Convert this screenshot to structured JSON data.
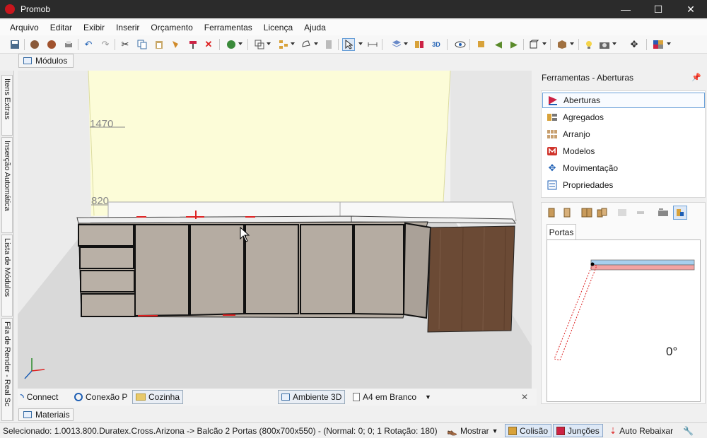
{
  "window": {
    "title": "Promob",
    "minimize": "—",
    "maximize": "☐",
    "close": "✕"
  },
  "menu": [
    "Arquivo",
    "Editar",
    "Exibir",
    "Inserir",
    "Orçamento",
    "Ferramentas",
    "Licença",
    "Ajuda"
  ],
  "toolbar_icons": [
    "save-icon",
    "render-icon",
    "render-settings-icon",
    "print-icon",
    "undo-icon",
    "redo-icon",
    "cut-icon",
    "copy-icon",
    "paste-icon",
    "paint-icon",
    "format-icon",
    "delete-icon",
    "budget-icon",
    "group-icon",
    "module-tree-icon",
    "shape-icon",
    "wall-icon",
    "pointer-icon",
    "measure-icon",
    "layers-icon",
    "elevation-icon",
    "3d-view-icon",
    "eye-icon",
    "rotate-icon",
    "move-left-icon",
    "move-right-icon",
    "view-cube-icon",
    "box-icon",
    "light-icon",
    "camera-icon",
    "move-cross-icon",
    "palette-icon"
  ],
  "modules_tab": {
    "label": "Módulos"
  },
  "side_tabs": [
    "Itens Extras",
    "Inserção Automática",
    "Lista de Módulos",
    "Fila de Render - Real Sc"
  ],
  "viewport": {
    "dimension_labels": [
      "1470",
      "820"
    ]
  },
  "view_tabs": {
    "connect": "Connect",
    "conexao": "Conexão P",
    "cozinha": "Cozinha",
    "ambiente": "Ambiente 3D",
    "a4": "A4 em Branco",
    "close": "✕"
  },
  "materials_tab": {
    "label": "Materiais"
  },
  "status": {
    "text": "Selecionado: 1.0013.800.Duratex.Cross.Arizona -> Balcão 2 Portas (800x700x550) - (Normal: 0; 0; 1 Rotação: 180)",
    "mostrar": "Mostrar",
    "colisao": "Colisão",
    "juncoes": "Junções",
    "auto_rebaixar": "Auto Rebaixar"
  },
  "panel": {
    "title": "Ferramentas - Aberturas",
    "pin": "📌",
    "tools": [
      "Aberturas",
      "Agregados",
      "Arranjo",
      "Modelos",
      "Movimentação",
      "Propriedades"
    ],
    "selected_tool": "Aberturas",
    "doors_tab": "Portas",
    "angle": "0°"
  },
  "colors": {
    "wall_highlight": "#fcfcd8",
    "cabinet": "#b5aca2",
    "wood": "#6b4a35",
    "door_blue": "#a7cfee",
    "door_red": "#f2a3a3"
  }
}
